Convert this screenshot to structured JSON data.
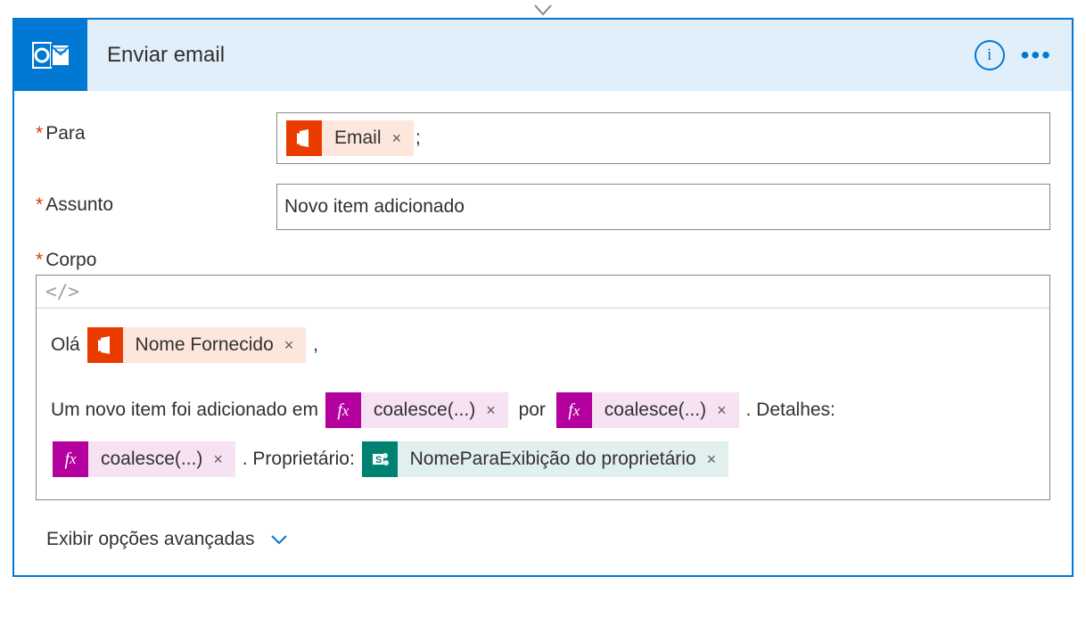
{
  "header": {
    "title": "Enviar email"
  },
  "fields": {
    "para": {
      "label": "Para",
      "token_label": "Email",
      "trailing": ";"
    },
    "assunto": {
      "label": "Assunto",
      "value": "Novo item adicionado"
    },
    "corpo": {
      "label": "Corpo",
      "toolbar": "</>",
      "line1_prefix": "Olá",
      "line1_token": "Nome Fornecido",
      "line1_suffix": ",",
      "line2_a": "Um novo item foi adicionado em",
      "line2_fx1": "coalesce(...)",
      "line2_b": "por",
      "line2_fx2": "coalesce(...)",
      "line2_c": ". Detalhes:",
      "line3_fx": "coalesce(...)",
      "line3_a": ". Proprietário:",
      "line3_sp": "NomeParaExibição do proprietário"
    }
  },
  "footer": {
    "advanced": "Exibir opções avançadas"
  },
  "glyphs": {
    "close": "×"
  }
}
